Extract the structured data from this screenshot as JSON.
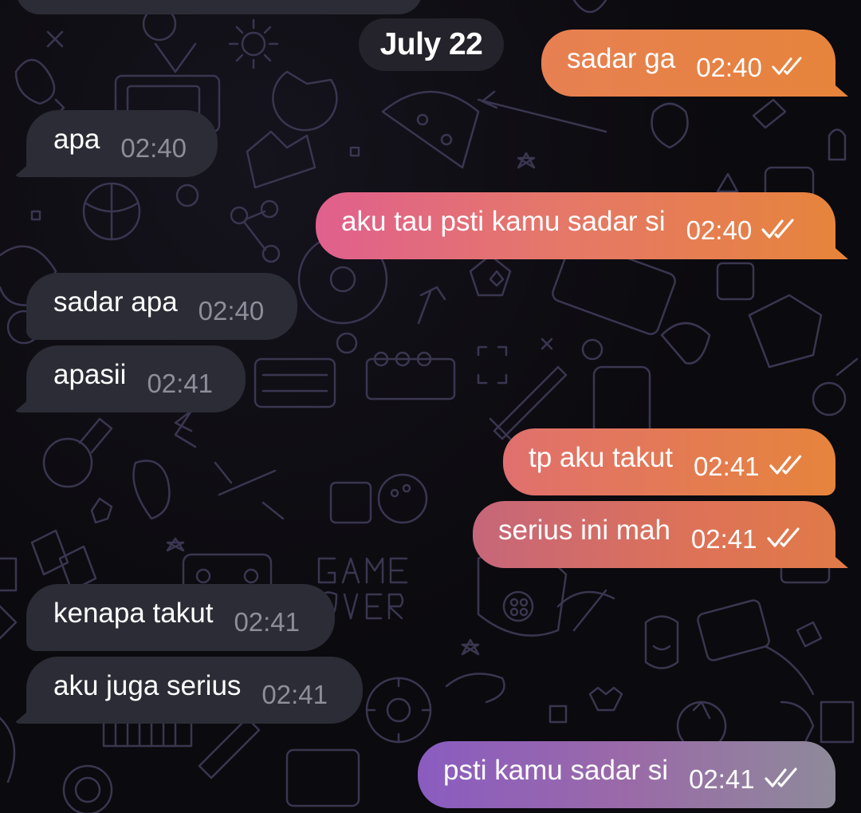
{
  "date_label": "July 22",
  "messages": [
    {
      "dir": "out",
      "text": "sadar ga",
      "time": "02:40",
      "status": "read"
    },
    {
      "dir": "in",
      "text": "apa",
      "time": "02:40"
    },
    {
      "dir": "out",
      "text": "aku tau psti kamu sadar si",
      "time": "02:40",
      "status": "read"
    },
    {
      "dir": "in",
      "text": "sadar apa",
      "time": "02:40"
    },
    {
      "dir": "in",
      "text": "apasii",
      "time": "02:41"
    },
    {
      "dir": "out",
      "text": "tp aku takut",
      "time": "02:41",
      "status": "read"
    },
    {
      "dir": "out",
      "text": "serius ini mah",
      "time": "02:41",
      "status": "read"
    },
    {
      "dir": "in",
      "text": "kenapa takut",
      "time": "02:41"
    },
    {
      "dir": "in",
      "text": "aku juga serius",
      "time": "02:41"
    },
    {
      "dir": "out",
      "text": "psti kamu sadar si",
      "time": "02:41",
      "status": "read"
    }
  ],
  "colors": {
    "incoming_bubble": "#2c2c36",
    "outgoing_orange": "#e6843c",
    "outgoing_pink": "#e0608e",
    "outgoing_rose": "#c6667a",
    "outgoing_purple": "#8a5cc0",
    "background": "#0b0a0e"
  },
  "icons": {
    "read_receipt": "double-check-icon"
  }
}
